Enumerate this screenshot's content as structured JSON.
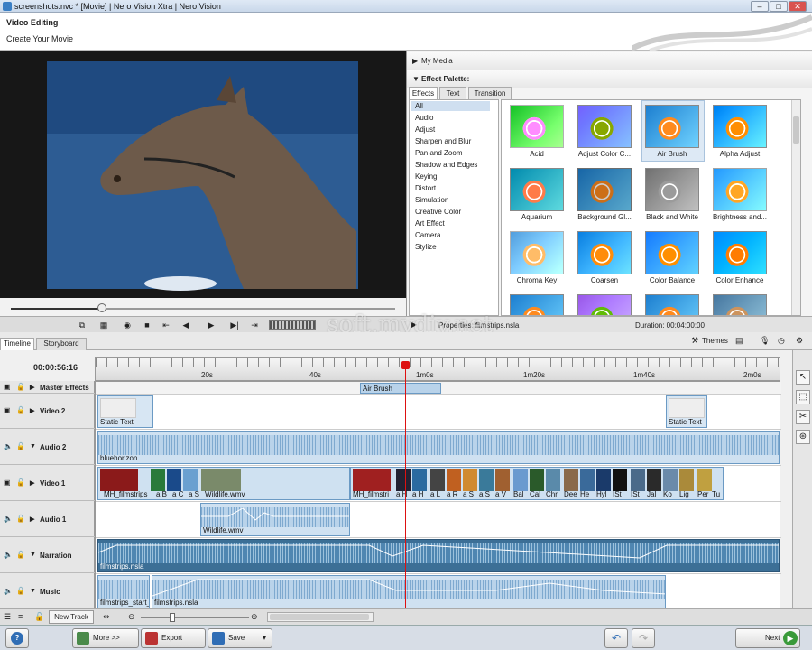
{
  "window": {
    "title": "screenshots.nvc * [Movie] | Nero Vision Xtra | Nero Vision",
    "min": "–",
    "max": "□",
    "close": "✕"
  },
  "header": {
    "title": "Video Editing",
    "subtitle": "Create Your Movie"
  },
  "panels": {
    "my_media": "My Media",
    "effect_palette": "Effect Palette:",
    "tabs": [
      "Effects",
      "Text",
      "Transition"
    ],
    "categories": [
      "All",
      "Audio",
      "Adjust",
      "Sharpen and Blur",
      "Pan and Zoom",
      "Shadow and Edges",
      "Keying",
      "Distort",
      "Simulation",
      "Creative Color",
      "Art Effect",
      "Camera",
      "Stylize"
    ],
    "effects": [
      "Acid",
      "Adjust Color C...",
      "Air Brush",
      "Alpha Adjust",
      "Aquarium",
      "Background Gl...",
      "Black and White",
      "Brightness and...",
      "Chroma Key",
      "Coarsen",
      "Color Balance",
      "Color Enhance"
    ],
    "properties": "Properties: filmstrips.nsla",
    "duration": "Duration: 00:04:00:00"
  },
  "timeline": {
    "tabs": [
      "Timeline",
      "Storyboard"
    ],
    "themes": "Themes",
    "timecode": "00:00:56:16",
    "ruler": [
      "20s",
      "40s",
      "1m0s",
      "1m20s",
      "1m40s",
      "2m0s"
    ],
    "tracks": [
      "Master Effects",
      "Video 2",
      "Audio 2",
      "Video 1",
      "Audio 1",
      "Narration",
      "Music"
    ],
    "clips": {
      "air_brush": "Air Brush",
      "static_text_1": "Static Text",
      "static_text_2": "Static Text",
      "bluehorizon": "bluehorizon",
      "v1_mh1": "MH_filmstrips",
      "v1_wildlife": "Wildlife.wmv",
      "v1_mh2": "MH_filmstri",
      "a1_wildlife": "Wildlife.wmv",
      "narration": "filmstrips.nsla",
      "music_1": "filmstrips_start_a",
      "music_2": "filmstrips.nsla"
    },
    "small_labels_1": [
      "a B",
      "a C",
      "a S"
    ],
    "small_labels_2": [
      "a H",
      "a H",
      "a L",
      "a R",
      "a S",
      "a S",
      "a V",
      "Bal",
      "Cal",
      "Chr",
      "Dee",
      "He",
      "Hyl",
      "ISt",
      "ISt",
      "Jal",
      "Ko",
      "Lig",
      "Per",
      "Tu"
    ],
    "new_track": "New Track"
  },
  "bottom": {
    "help": "?",
    "more": "More >>",
    "export": "Export",
    "save": "Save",
    "next": "Next"
  },
  "watermark": "soft.mydiv.net",
  "colors": {
    "accent": "#3b7fc4",
    "playhead": "#dd1111",
    "clip": "#cfe1f1",
    "clip_dark": "#3c6f96"
  }
}
